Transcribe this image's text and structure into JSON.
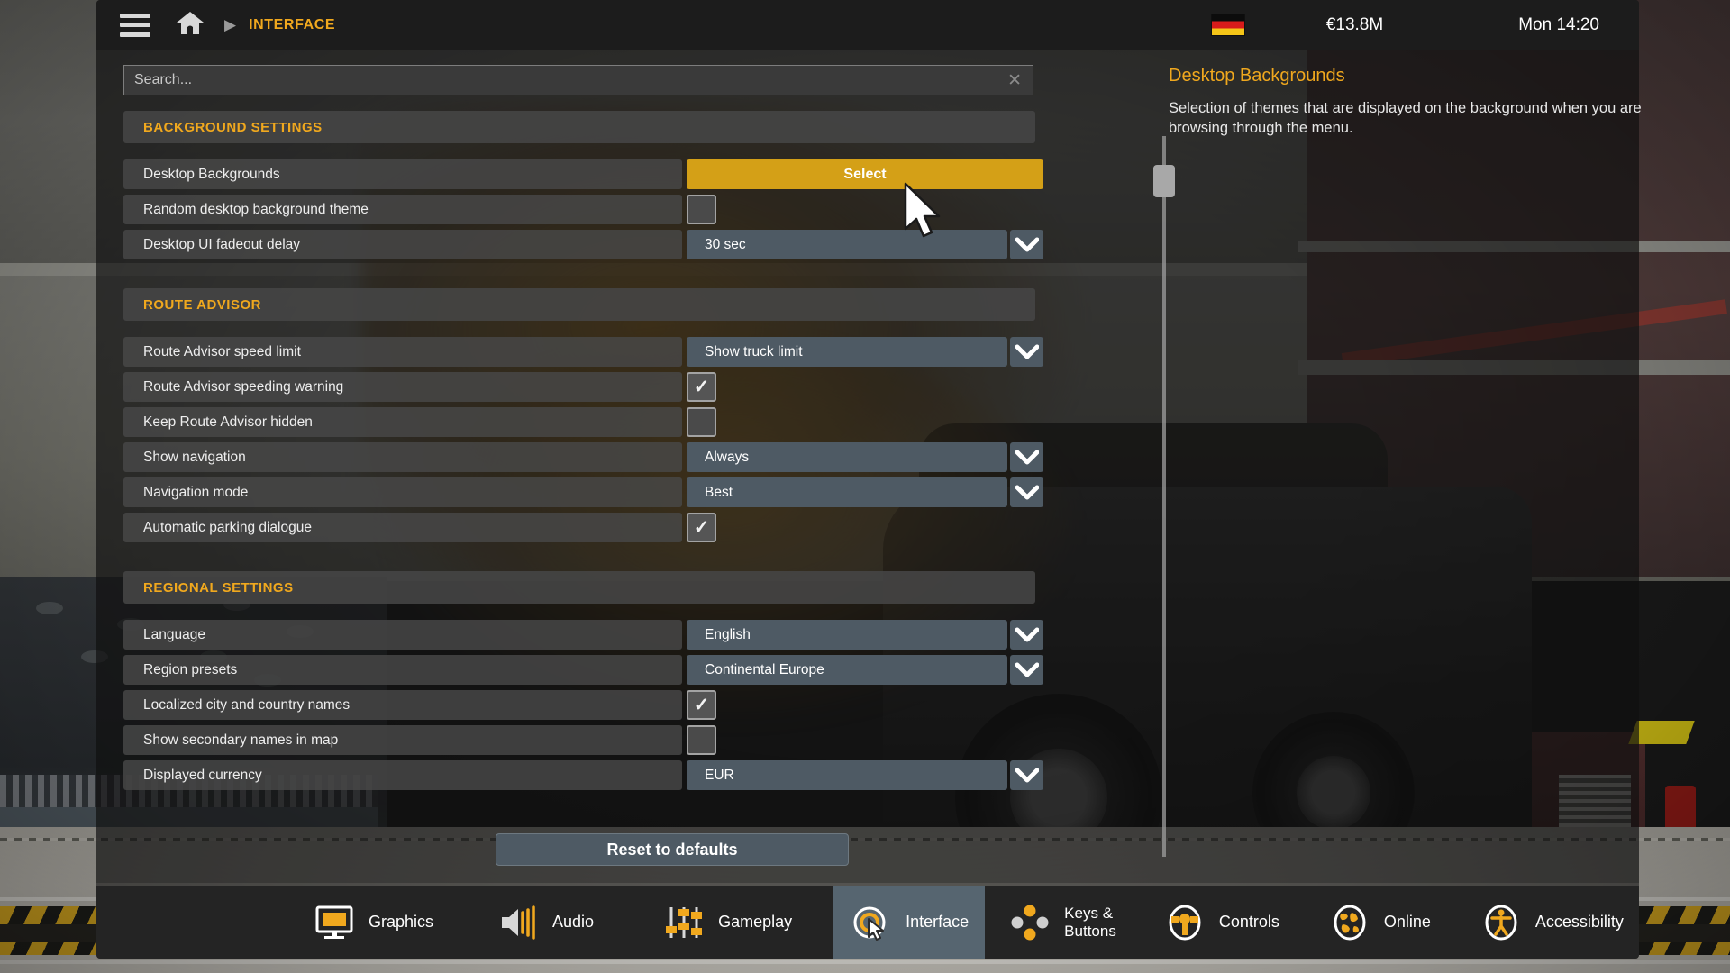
{
  "topbar": {
    "menu_icon": "hamburger-icon",
    "home_icon": "home-icon",
    "separator": "▶",
    "breadcrumb": "INTERFACE",
    "flag": "german-flag-icon",
    "money": "€13.8M",
    "clock": "Mon 14:20"
  },
  "search": {
    "placeholder": "Search...",
    "value": "",
    "clear_label": "✕"
  },
  "sections": [
    {
      "title": "BACKGROUND SETTINGS",
      "rows": [
        {
          "label": "Desktop Backgrounds",
          "control": "button",
          "value": "Select"
        },
        {
          "label": "Random desktop background theme",
          "control": "checkbox",
          "checked": false
        },
        {
          "label": "Desktop UI fadeout delay",
          "control": "dropdown",
          "value": "30 sec"
        }
      ]
    },
    {
      "title": "ROUTE ADVISOR",
      "rows": [
        {
          "label": "Route Advisor speed limit",
          "control": "dropdown",
          "value": "Show truck limit"
        },
        {
          "label": "Route Advisor speeding warning",
          "control": "checkbox",
          "checked": true
        },
        {
          "label": "Keep Route Advisor hidden",
          "control": "checkbox",
          "checked": false
        },
        {
          "label": "Show navigation",
          "control": "dropdown",
          "value": "Always"
        },
        {
          "label": "Navigation mode",
          "control": "dropdown",
          "value": "Best"
        },
        {
          "label": "Automatic parking dialogue",
          "control": "checkbox",
          "checked": true
        }
      ]
    },
    {
      "title": "REGIONAL SETTINGS",
      "rows": [
        {
          "label": "Language",
          "control": "dropdown",
          "value": "English"
        },
        {
          "label": "Region presets",
          "control": "dropdown",
          "value": "Continental Europe"
        },
        {
          "label": "Localized city and country names",
          "control": "checkbox",
          "checked": true
        },
        {
          "label": "Show secondary names in map",
          "control": "checkbox",
          "checked": false
        },
        {
          "label": "Displayed currency",
          "control": "dropdown",
          "value": "EUR"
        }
      ]
    }
  ],
  "info_panel": {
    "title": "Desktop Backgrounds",
    "description": "Selection of themes that are displayed on the background when you are browsing through the menu."
  },
  "reset": {
    "label": "Reset to defaults"
  },
  "tabs": [
    {
      "label": "Graphics",
      "icon": "monitor-icon",
      "active": false
    },
    {
      "label": "Audio",
      "icon": "speaker-icon",
      "active": false
    },
    {
      "label": "Gameplay",
      "icon": "sliders-icon",
      "active": false
    },
    {
      "label": "Interface",
      "icon": "cursor-target-icon",
      "active": true
    },
    {
      "label": "Keys &\nButtons",
      "icon": "dpad-icon",
      "active": false
    },
    {
      "label": "Controls",
      "icon": "steering-wheel-icon",
      "active": false
    },
    {
      "label": "Online",
      "icon": "globe-icon",
      "active": false
    },
    {
      "label": "Accessibility",
      "icon": "accessibility-icon",
      "active": false
    }
  ],
  "colors": {
    "accent_gold": "#f0a81e",
    "button_gold": "#d4a017",
    "dropdown_blue": "#4e5a64",
    "panel_dark": "#1c1c1c",
    "tab_active": "#566570"
  }
}
